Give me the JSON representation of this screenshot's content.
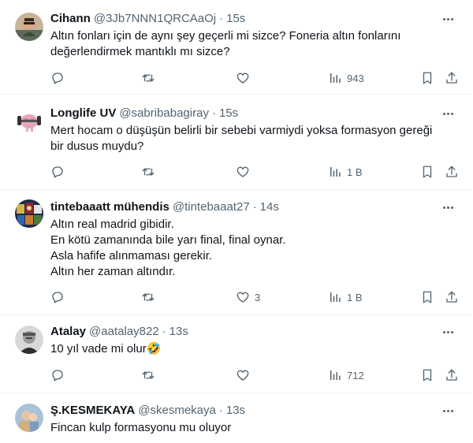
{
  "tweets": [
    {
      "name": "Cihann",
      "handle": "@3Jb7NNN1QRCAaOj",
      "separator": "·",
      "time": "15s",
      "lines": [
        "Altın fonları için de aynı şey geçerli mi sizce? Foneria altın fonlarını",
        "değerlendirmek mantıklı mı sizce?"
      ],
      "likes": "",
      "views": "943"
    },
    {
      "name": "Longlife UV",
      "handle": "@sabribabagiray",
      "separator": "·",
      "time": "15s",
      "lines": [
        "Mert hocam o düşüşün belirli bir sebebi varmiydi yoksa formasyon gereği",
        "bir dusus muydu?"
      ],
      "likes": "",
      "views": "1 B"
    },
    {
      "name": "tintebaaatt mühendis",
      "handle": "@tintebaaat27",
      "separator": "·",
      "time": "14s",
      "lines": [
        "Altın real madrid gibidir.",
        "En kötü zamanında bile yarı final, final oynar.",
        "Asla hafife alınmaması gerekir.",
        "Altın her zaman altındır."
      ],
      "likes": "3",
      "views": "1 B"
    },
    {
      "name": "Atalay",
      "handle": "@aatalay822",
      "separator": "·",
      "time": "13s",
      "lines": [
        "10 yıl vade mi olur🤣"
      ],
      "likes": "",
      "views": "712"
    },
    {
      "name": "Ş.KESMEKAYA",
      "handle": "@skesmekaya",
      "separator": "·",
      "time": "13s",
      "lines": [
        "Fincan kulp formasyonu mu oluyor"
      ],
      "likes": "",
      "views": ""
    }
  ],
  "icons": {
    "reply": "reply-icon",
    "retweet": "retweet-icon",
    "like": "like-icon",
    "views": "views-icon",
    "bookmark": "bookmark-icon",
    "share": "share-icon",
    "more": "more-icon"
  },
  "colors": {
    "text": "#0f1419",
    "secondary": "#536471",
    "border": "#eff3f4"
  }
}
